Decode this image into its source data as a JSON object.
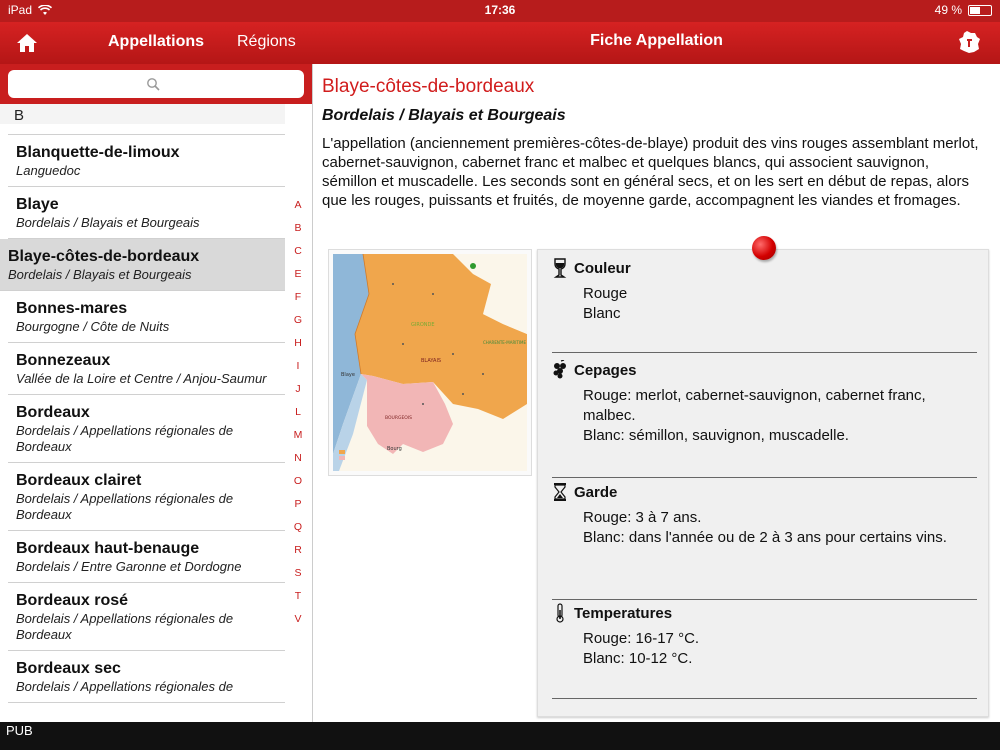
{
  "status": {
    "device": "iPad",
    "time": "17:36",
    "battery": "49 %",
    "battery_level": 0.49
  },
  "nav": {
    "tab_appellations": "Appellations",
    "tab_regions": "Régions",
    "title": "Fiche Appellation"
  },
  "sidebar": {
    "search_placeholder": "",
    "section_letter": "B",
    "items": [
      {
        "title": "Blanquette-de-limoux",
        "subtitle": "Languedoc"
      },
      {
        "title": "Blaye",
        "subtitle": "Bordelais / Blayais et Bourgeais"
      },
      {
        "title": "Blaye-côtes-de-bordeaux",
        "subtitle": "Bordelais / Blayais et Bourgeais"
      },
      {
        "title": "Bonnes-mares",
        "subtitle": "Bourgogne / Côte de Nuits"
      },
      {
        "title": "Bonnezeaux",
        "subtitle": "Vallée de la Loire et Centre / Anjou-Saumur"
      },
      {
        "title": "Bordeaux",
        "subtitle": "Bordelais / Appellations régionales de Bordeaux"
      },
      {
        "title": "Bordeaux clairet",
        "subtitle": "Bordelais / Appellations régionales de Bordeaux"
      },
      {
        "title": "Bordeaux haut-benauge",
        "subtitle": "Bordelais / Entre Garonne et Dordogne"
      },
      {
        "title": "Bordeaux rosé",
        "subtitle": "Bordelais / Appellations régionales de Bordeaux"
      },
      {
        "title": "Bordeaux sec",
        "subtitle": "Bordelais / Appellations régionales de"
      }
    ],
    "index_letters": [
      "A",
      "B",
      "C",
      "E",
      "F",
      "G",
      "H",
      "I",
      "J",
      "L",
      "M",
      "N",
      "O",
      "P",
      "Q",
      "R",
      "S",
      "T",
      "V"
    ]
  },
  "detail": {
    "title": "Blaye-côtes-de-bordeaux",
    "subtitle": "Bordelais / Blayais et Bourgeais",
    "description": "L'appellation (anciennement premières-côtes-de-blaye) produit des vins rouges assemblant merlot, cabernet-sauvignon, cabernet franc et malbec et quelques blancs, qui associent sauvignon, sémillon et muscadelle. Les seconds sont en général secs, et on les sert en début de repas, alors que les rouges, puissants et fruités, de moyenne garde, accompagnent les viandes et fromages.",
    "map_labels": {
      "gironde": "GIRONDE",
      "blayais": "BLAYAIS",
      "bourgeais": "BOURGEOIS",
      "charente": "CHARENTE-MARITIME",
      "blaye": "Blaye",
      "bourg": "Bourg"
    },
    "couleur": {
      "label": "Couleur",
      "lines": [
        "Rouge",
        "Blanc"
      ]
    },
    "cepages": {
      "label": "Cepages",
      "lines": [
        "Rouge: merlot, cabernet-sauvignon, cabernet franc, malbec.",
        "Blanc: sémillon, sauvignon, muscadelle."
      ]
    },
    "garde": {
      "label": "Garde",
      "lines": [
        "Rouge: 3 à 7 ans.",
        "Blanc: dans l'année ou de 2 à 3 ans pour certains vins."
      ]
    },
    "temperatures": {
      "label": "Temperatures",
      "lines": [
        "Rouge: 16-17 °C.",
        "Blanc: 10-12 °C."
      ]
    }
  },
  "footer": {
    "label": "PUB"
  },
  "colors": {
    "accent": "#c81e1e",
    "title_red": "#d11c1c",
    "map_orange": "#f0a64c",
    "map_pink": "#f2b6b6",
    "map_water": "#8fb7d8"
  }
}
